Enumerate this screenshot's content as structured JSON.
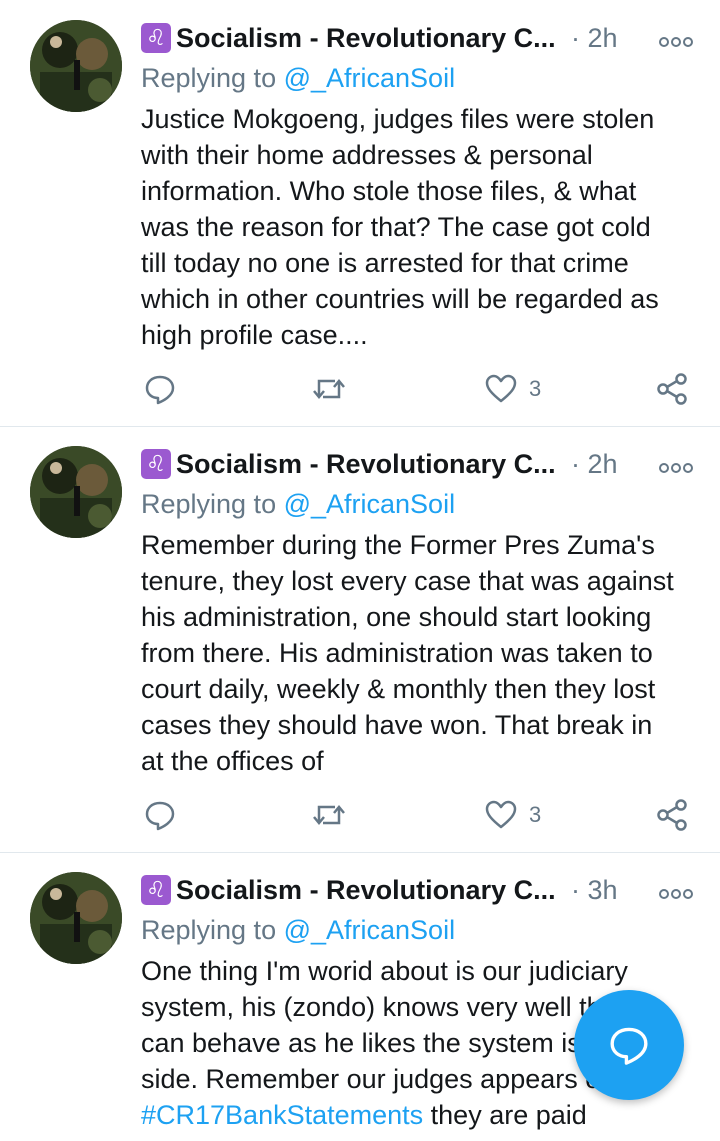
{
  "tweets": [
    {
      "display_name": "Socialism - Revolutionary C...",
      "badge_glyph": "♌",
      "timestamp": "· 2h",
      "reply_prefix": "Replying to ",
      "reply_handle": "@_AfricanSoil",
      "text_lines": [
        "Justice Mokgoeng, judges files were stolen",
        "with their home addresses & personal",
        "information. Who stole those files, & what",
        "was the reason for that? The case got cold",
        "till today no one is arrested for that crime",
        "which in other countries will be regarded as",
        "high profile case...."
      ],
      "like_count": "3"
    },
    {
      "display_name": "Socialism - Revolutionary C...",
      "badge_glyph": "♌",
      "timestamp": "· 2h",
      "reply_prefix": "Replying to ",
      "reply_handle": "@_AfricanSoil",
      "text_lines": [
        "Remember during the Former Pres Zuma's",
        "tenure, they lost every case that was against",
        "his administration, one should start looking",
        "from there. His administration was taken to",
        "court daily, weekly & monthly then they lost",
        "cases they should have won. That break in",
        "at the offices of"
      ],
      "like_count": "3"
    },
    {
      "display_name": "Socialism - Revolutionary C...",
      "badge_glyph": "♌",
      "timestamp": "· 3h",
      "reply_prefix": "Replying to ",
      "reply_handle": "@_AfricanSoil",
      "text_lines": [
        "One thing I'm worid about is our judiciary",
        "system, his (zondo) knows very well that he",
        "can behave as he likes the system is on his",
        "side. Remember our judges appears on",
        "#CR17BankStatements they are paid"
      ],
      "hashtag": "#CR17BankStatements",
      "last_line_rest": " they are paid"
    }
  ],
  "colors": {
    "accent": "#1da1f2",
    "muted": "#657786",
    "badge": "#9b59d0",
    "divider": "#e1e8ed"
  },
  "icons": {
    "reply": "reply-icon",
    "retweet": "retweet-icon",
    "like": "heart-icon",
    "share": "share-icon",
    "more": "more-options-icon",
    "compose": "compose-reply-icon"
  }
}
